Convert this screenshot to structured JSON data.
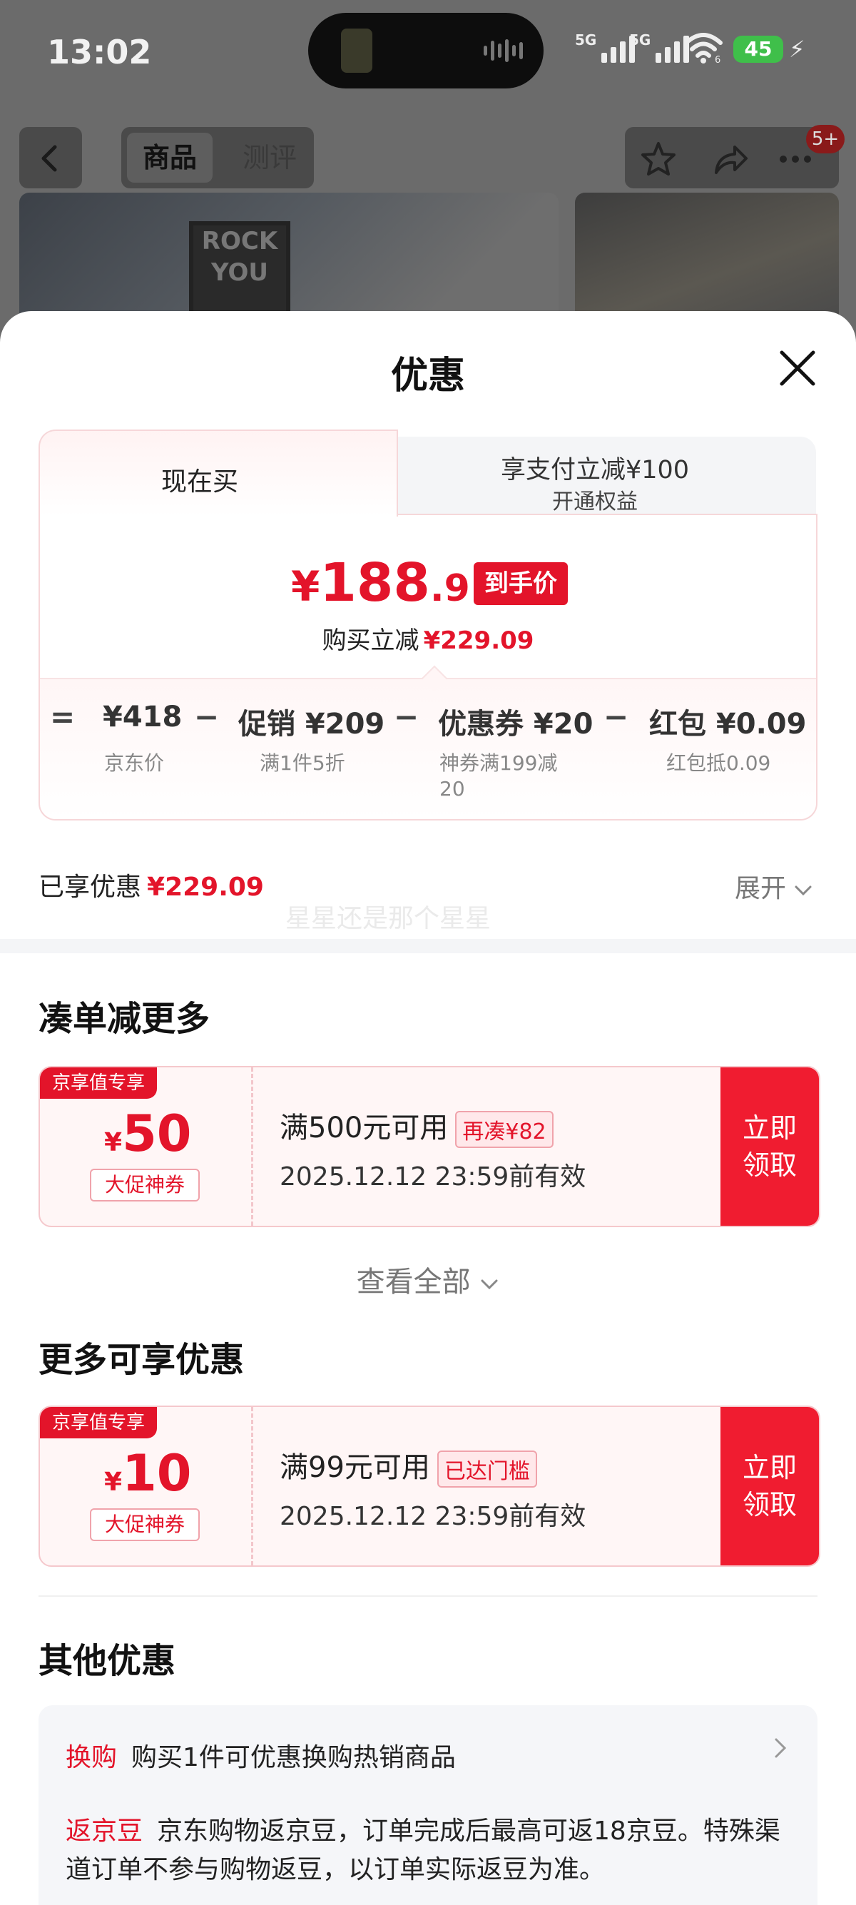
{
  "status_bar": {
    "time": "13:02",
    "network_1": "5G",
    "network_2": "5G",
    "wifi_badge": "6",
    "battery": "45",
    "icons": [
      "signal-icon",
      "wifi-icon",
      "battery-icon",
      "charging-bolt-icon"
    ]
  },
  "nav": {
    "tabs": [
      {
        "label": "商品",
        "active": true
      },
      {
        "label": "测评",
        "active": false
      }
    ],
    "badge": "5+",
    "icons": [
      "back-icon",
      "star-icon",
      "share-icon",
      "more-icon"
    ]
  },
  "background_photo": {
    "poster_text": [
      "ROCK",
      "YOU"
    ]
  },
  "sheet": {
    "title": "优惠",
    "tabs": {
      "now": "现在买",
      "pay_main": "享支付立减¥100",
      "pay_sub": "开通权益"
    },
    "final": {
      "currency": "¥",
      "integer": "188",
      "decimal": ".91",
      "tag": "到手价"
    },
    "reduce": {
      "label": "购买立减",
      "value": "¥229.09"
    },
    "breakdown": [
      {
        "op": "=",
        "value": "¥418",
        "desc": "京东价"
      },
      {
        "op": "−",
        "value": "促销 ¥209",
        "desc": "满1件5折"
      },
      {
        "op": "−",
        "value": "优惠券 ¥20",
        "desc": "神券满199减20"
      },
      {
        "op": "−",
        "value": "红包 ¥0.09",
        "desc": "红包抵0.09"
      }
    ],
    "enjoyed": {
      "label": "已享优惠",
      "value": "¥229.09"
    },
    "expand": "展开",
    "watermark": "星星还是那个星星",
    "section_more": "凑单减更多",
    "coupon_1": {
      "tag": "京享值专享",
      "currency": "¥",
      "amount": "50",
      "kind": "大促神券",
      "condition": "满500元可用",
      "hint": "再凑¥82",
      "expiry": "2025.12.12 23:59前有效",
      "claim": "立即领取"
    },
    "view_all": "查看全部",
    "section_available": "更多可享优惠",
    "coupon_2": {
      "tag": "京享值专享",
      "currency": "¥",
      "amount": "10",
      "kind": "大促神券",
      "condition": "满99元可用",
      "hint": "已达门槛",
      "expiry": "2025.12.12 23:59前有效",
      "claim": "立即领取"
    },
    "section_other": "其他优惠",
    "other": {
      "exchange_key": "换购",
      "exchange_text": "购买1件可优惠换购热销商品",
      "bean_key": "返京豆",
      "bean_text": "京东购物返京豆，订单完成后最高可返18京豆。特殊渠道订单不参与购物返豆，以订单实际返豆为准。"
    }
  },
  "colors": {
    "accent_red": "#e3142a",
    "dim_overlay": "#6b6b6b",
    "coupon_bg": "#fff6f6"
  }
}
